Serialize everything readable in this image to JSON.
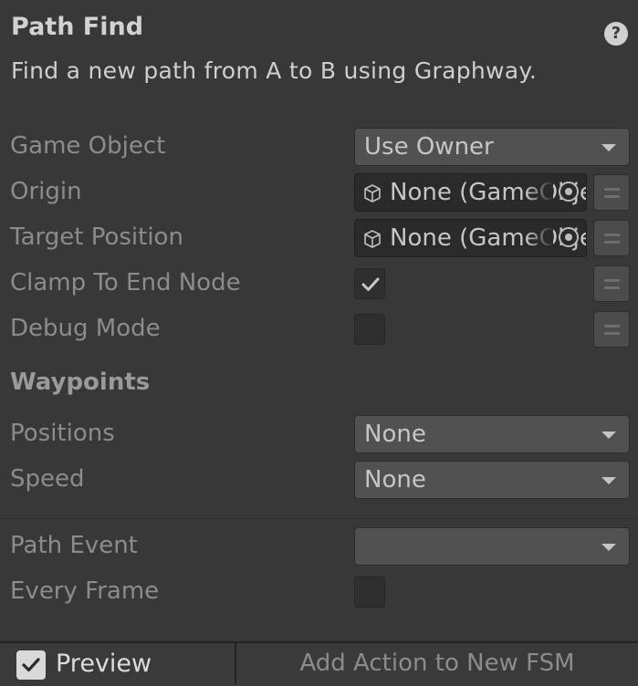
{
  "header": {
    "title": "Path Find",
    "description": "Find a new path from A to B using Graphway.",
    "help_icon": "help-icon",
    "help_glyph": "?"
  },
  "fields": {
    "game_object": {
      "label": "Game Object",
      "value": "Use Owner"
    },
    "origin": {
      "label": "Origin",
      "value": "None (GameObject)"
    },
    "target_position": {
      "label": "Target Position",
      "value": "None (GameObject)"
    },
    "clamp_to_end_node": {
      "label": "Clamp To End Node",
      "checked": true
    },
    "debug_mode": {
      "label": "Debug Mode",
      "checked": false
    }
  },
  "waypoints": {
    "heading": "Waypoints",
    "positions": {
      "label": "Positions",
      "value": "None"
    },
    "speed": {
      "label": "Speed",
      "value": "None"
    }
  },
  "events": {
    "path_event": {
      "label": "Path Event",
      "value": ""
    },
    "every_frame": {
      "label": "Every Frame",
      "checked": false
    }
  },
  "footer": {
    "preview_label": "Preview",
    "preview_checked": true,
    "add_action_label": "Add Action to New FSM"
  },
  "colors": {
    "background": "#383838",
    "field": "#515151",
    "object_field": "#2a2a2a"
  }
}
